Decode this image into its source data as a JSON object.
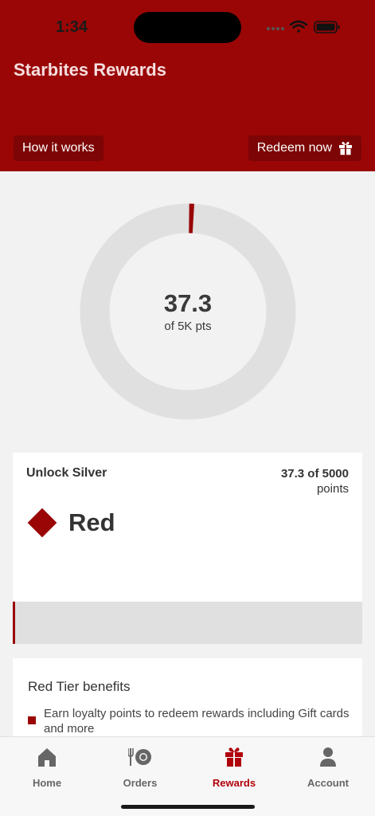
{
  "status_bar": {
    "time": "1:34"
  },
  "header": {
    "title": "Starbites Rewards",
    "how_it_works": "How it works",
    "redeem_now": "Redeem now"
  },
  "progress_ring": {
    "value": "37.3",
    "caption": "of 5K pts",
    "current": 37.3,
    "max": 5000
  },
  "tier_card": {
    "unlock_label": "Unlock Silver",
    "points_main": "37.3 of 5000",
    "points_unit": "points",
    "tier_name": "Red",
    "progress_fraction": 0.00746
  },
  "benefits": {
    "title": "Red Tier benefits",
    "items": [
      "Earn loyalty points to redeem rewards including Gift cards and more"
    ]
  },
  "tabbar": {
    "tabs": [
      {
        "label": "Home",
        "icon": "home-icon"
      },
      {
        "label": "Orders",
        "icon": "cutlery-plate-icon"
      },
      {
        "label": "Rewards",
        "icon": "gift-icon",
        "active": true
      },
      {
        "label": "Account",
        "icon": "person-icon"
      }
    ]
  },
  "colors": {
    "brand_red": "#9a0606",
    "tab_active": "#b0000a",
    "ring_track": "#e0e0e0"
  }
}
